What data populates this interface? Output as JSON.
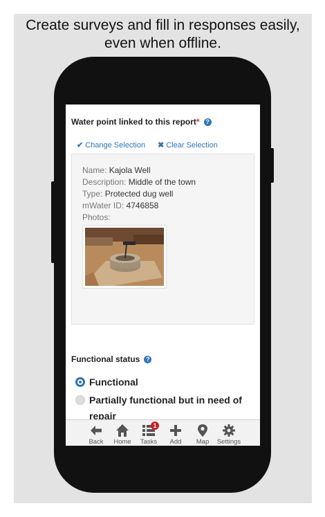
{
  "headline": {
    "line1": "Create surveys and fill in responses easily,",
    "line2": "even when offline."
  },
  "form": {
    "water_point": {
      "label": "Water point linked to this report",
      "required_marker": "*",
      "change_selection": "Change Selection",
      "clear_selection": "Clear Selection",
      "details": {
        "name_key": "Name:",
        "name_value": "Kajola Well",
        "description_key": "Description:",
        "description_value": "Middle of the town",
        "type_key": "Type:",
        "type_value": "Protected dug well",
        "mwater_id_key": "mWater ID:",
        "mwater_id_value": "4746858",
        "photos_key": "Photos:"
      }
    },
    "functional_status": {
      "label": "Functional status",
      "options": [
        {
          "label": "Functional",
          "selected": true
        },
        {
          "label": "Partially functional but in need of repair",
          "line1": "Partially functional but in need of",
          "line2": "repair",
          "selected": false
        }
      ]
    }
  },
  "tabbar": {
    "tabs": [
      {
        "label": "Back",
        "icon": "arrow-left-icon"
      },
      {
        "label": "Home",
        "icon": "home-icon"
      },
      {
        "label": "Tasks",
        "icon": "tasks-list-icon",
        "badge": "1"
      },
      {
        "label": "Add",
        "icon": "plus-icon"
      },
      {
        "label": "Map",
        "icon": "map-pin-icon"
      },
      {
        "label": "Settings",
        "icon": "gear-icon"
      }
    ]
  },
  "colors": {
    "accent": "#2e74b5",
    "required": "#d62b2b",
    "badge": "#cc1f1f",
    "phone_body": "#111111",
    "backdrop": "#e3e3e3"
  }
}
